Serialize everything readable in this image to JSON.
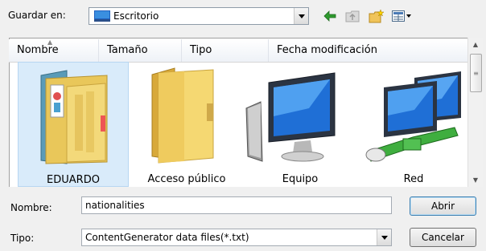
{
  "toolbar": {
    "save_in_label": "Guardar en:",
    "location": "Escritorio",
    "icons": [
      "back-arrow-icon",
      "up-folder-icon",
      "new-folder-icon",
      "view-menu-icon"
    ]
  },
  "columns": [
    "Nombre",
    "Tamaño",
    "Tipo",
    "Fecha modificación"
  ],
  "items": [
    {
      "name": "EDUARDO",
      "icon": "user-folder-icon",
      "selected": true
    },
    {
      "name": "Acceso público",
      "icon": "folder-icon",
      "selected": false
    },
    {
      "name": "Equipo",
      "icon": "computer-icon",
      "selected": false
    },
    {
      "name": "Red",
      "icon": "network-icon",
      "selected": false
    }
  ],
  "form": {
    "name_label": "Nombre:",
    "name_value": "nationalities",
    "type_label": "Tipo:",
    "type_value": "ContentGenerator data files(*.txt)"
  },
  "buttons": {
    "open": "Abrir",
    "cancel": "Cancelar"
  },
  "colors": {
    "window_bg": "#f0f0f0",
    "selection_bg": "#d9ebfa",
    "selection_border": "#b7d6f2"
  }
}
